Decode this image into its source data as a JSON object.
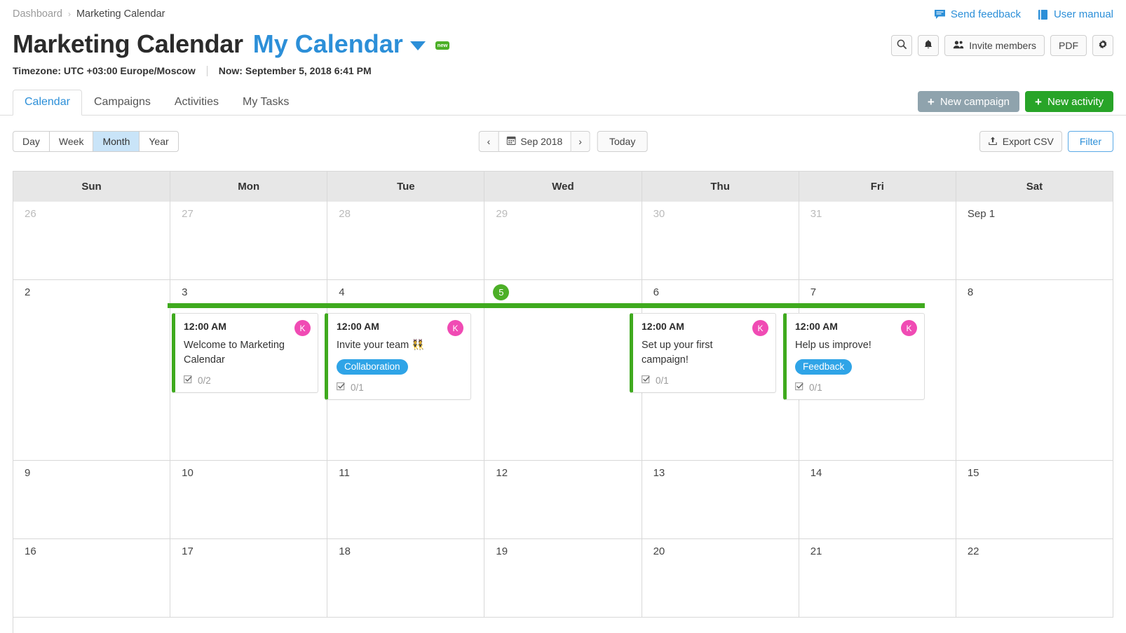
{
  "breadcrumb": {
    "parent": "Dashboard",
    "separator": "›",
    "current": "Marketing Calendar"
  },
  "toplinks": [
    {
      "label": "Send feedback",
      "icon": "chat-bubble-icon"
    },
    {
      "label": "User manual",
      "icon": "book-icon"
    }
  ],
  "header": {
    "title": "Marketing Calendar",
    "calendar_selector": "My Calendar",
    "new_badge": "new",
    "timezone": "Timezone: UTC +03:00 Europe/Moscow",
    "now": "Now: September 5, 2018 6:41 PM",
    "buttons": {
      "search": "search-icon",
      "notifications": "bell-icon",
      "invite": "Invite members",
      "pdf": "PDF",
      "settings": "gear-icon"
    }
  },
  "tabs": [
    {
      "label": "Calendar",
      "active": true
    },
    {
      "label": "Campaigns",
      "active": false
    },
    {
      "label": "Activities",
      "active": false
    },
    {
      "label": "My Tasks",
      "active": false
    }
  ],
  "actions": {
    "new_campaign": "New campaign",
    "new_activity": "New activity"
  },
  "viewbar": {
    "views": [
      {
        "label": "Day",
        "active": false
      },
      {
        "label": "Week",
        "active": false
      },
      {
        "label": "Month",
        "active": true
      },
      {
        "label": "Year",
        "active": false
      }
    ],
    "prev": "‹",
    "period": "Sep 2018",
    "next": "›",
    "today": "Today",
    "export": "Export CSV",
    "filter": "Filter"
  },
  "calendar": {
    "day_names": [
      "Sun",
      "Mon",
      "Tue",
      "Wed",
      "Thu",
      "Fri",
      "Sat"
    ],
    "weeks": [
      {
        "days": [
          {
            "num": "26",
            "muted": true
          },
          {
            "num": "27",
            "muted": true
          },
          {
            "num": "28",
            "muted": true
          },
          {
            "num": "29",
            "muted": true
          },
          {
            "num": "30",
            "muted": true
          },
          {
            "num": "31",
            "muted": true
          },
          {
            "num": "Sep 1",
            "muted": false
          }
        ]
      },
      {
        "days": [
          {
            "num": "2",
            "muted": false
          },
          {
            "num": "3",
            "muted": false
          },
          {
            "num": "4",
            "muted": false
          },
          {
            "num": "5",
            "muted": false,
            "today": true
          },
          {
            "num": "6",
            "muted": false
          },
          {
            "num": "7",
            "muted": false
          },
          {
            "num": "8",
            "muted": false
          }
        ]
      },
      {
        "days": [
          {
            "num": "9",
            "muted": false
          },
          {
            "num": "10",
            "muted": false
          },
          {
            "num": "11",
            "muted": false
          },
          {
            "num": "12",
            "muted": false
          },
          {
            "num": "13",
            "muted": false
          },
          {
            "num": "14",
            "muted": false
          },
          {
            "num": "15",
            "muted": false
          }
        ]
      },
      {
        "days": [
          {
            "num": "16",
            "muted": false
          },
          {
            "num": "17",
            "muted": false
          },
          {
            "num": "18",
            "muted": false
          },
          {
            "num": "19",
            "muted": false
          },
          {
            "num": "20",
            "muted": false
          },
          {
            "num": "21",
            "muted": false
          },
          {
            "num": "22",
            "muted": false
          }
        ]
      }
    ],
    "events": [
      {
        "time": "12:00 AM",
        "title": "Welcome to Marketing Calendar",
        "tag": null,
        "checklist": "0/2",
        "avatar": "K"
      },
      {
        "time": "12:00 AM",
        "title": "Invite your team 👯",
        "tag": "Collaboration",
        "checklist": "0/1",
        "avatar": "K"
      },
      {
        "time": "12:00 AM",
        "title": "Set up your first campaign!",
        "tag": null,
        "checklist": "0/1",
        "avatar": "K"
      },
      {
        "time": "12:00 AM",
        "title": "Help us improve!",
        "tag": "Feedback",
        "checklist": "0/1",
        "avatar": "K"
      }
    ]
  },
  "colors": {
    "accent_blue": "#2c8fd8",
    "green": "#3faa1e",
    "today_green": "#4caf27",
    "tag_blue": "#2fa4e7",
    "avatar_pink": "#f04bb4",
    "grey_button": "#8fa3ad"
  }
}
